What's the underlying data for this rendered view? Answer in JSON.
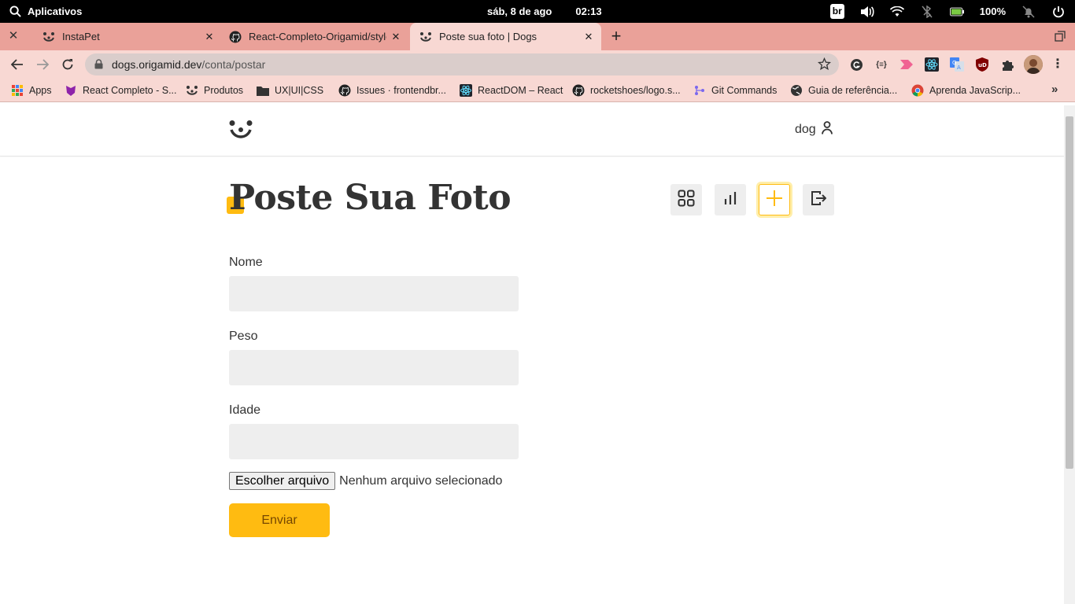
{
  "system_bar": {
    "apps_label": "Aplicativos",
    "date": "sáb,  8 de ago",
    "time": "02:13",
    "keyboard_layout": "br",
    "battery": "100%"
  },
  "tabs": [
    {
      "title": "InstaPet",
      "active": false
    },
    {
      "title": "React-Completo-Origamid/style",
      "active": false
    },
    {
      "title": "Poste sua foto | Dogs",
      "active": true
    }
  ],
  "address_bar": {
    "host": "dogs.origamid.dev",
    "path": "/conta/postar"
  },
  "bookmarks": [
    {
      "label": "Apps",
      "icon": "apps-grid-icon"
    },
    {
      "label": "React Completo - S...",
      "icon": "origamid-icon"
    },
    {
      "label": "Produtos",
      "icon": "dog-icon"
    },
    {
      "label": "UX|UI|CSS",
      "icon": "folder-icon"
    },
    {
      "label": "Issues · frontendbr...",
      "icon": "github-icon"
    },
    {
      "label": "ReactDOM – React",
      "icon": "react-icon"
    },
    {
      "label": "rocketshoes/logo.s...",
      "icon": "github-icon"
    },
    {
      "label": "Git Commands",
      "icon": "git-icon"
    },
    {
      "label": "Guia de referência...",
      "icon": "globe-icon"
    },
    {
      "label": "Aprenda JavaScrip...",
      "icon": "chrome-icon"
    }
  ],
  "site": {
    "user": "dog",
    "title": "Poste Sua Foto",
    "accent_color": "#ffbb11",
    "form": {
      "name_label": "Nome",
      "weight_label": "Peso",
      "age_label": "Idade",
      "file_button": "Escolher arquivo",
      "file_status": "Nenhum arquivo selecionado",
      "submit_label": "Enviar"
    }
  }
}
